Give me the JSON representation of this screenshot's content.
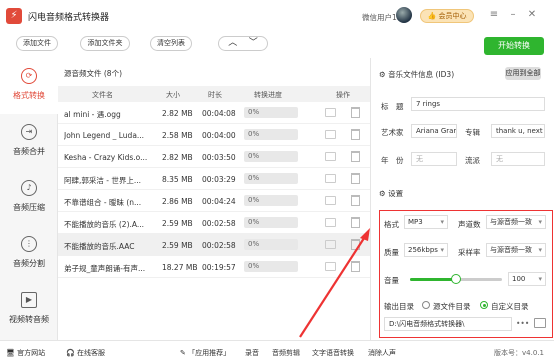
{
  "app": {
    "title": "闪电音频格式转换器",
    "username": "微信用户1",
    "member_label": "会员中心"
  },
  "toolbar": {
    "add_file": "添加文件",
    "add_folder": "添加文件夹",
    "clear_list": "清空列表",
    "nav_up": "︿",
    "nav_down": "﹀",
    "start": "开始转换"
  },
  "sidebar": {
    "items": [
      {
        "label": "格式转换",
        "icon": "convert-icon",
        "active": true
      },
      {
        "label": "音频合并",
        "icon": "merge-icon"
      },
      {
        "label": "音频压缩",
        "icon": "compress-icon"
      },
      {
        "label": "音频分割",
        "icon": "split-icon"
      },
      {
        "label": "视频转音频",
        "icon": "video-icon"
      }
    ]
  },
  "filelist": {
    "title": "源音频文件 (8个)",
    "columns": [
      "文件名",
      "大小",
      "时长",
      "转换进度",
      "操作"
    ],
    "rows": [
      {
        "name": "al mini - 遇.ogg",
        "size": "2.82 MB",
        "duration": "00:04:08",
        "progress": "0%"
      },
      {
        "name": "John Legend _ Luda...",
        "size": "2.58 MB",
        "duration": "00:04:00",
        "progress": "0%"
      },
      {
        "name": "Kesha - Crazy Kids.o...",
        "size": "2.82 MB",
        "duration": "00:03:50",
        "progress": "0%"
      },
      {
        "name": "阿肆,郭采洁 - 世界上...",
        "size": "8.35 MB",
        "duration": "00:03:29",
        "progress": "0%"
      },
      {
        "name": "不靠谱组合 - 暧昧 (n...",
        "size": "2.86 MB",
        "duration": "00:04:24",
        "progress": "0%"
      },
      {
        "name": "不能播放的音乐 (2).A...",
        "size": "2.59 MB",
        "duration": "00:02:58",
        "progress": "0%"
      },
      {
        "name": "不能播放的音乐.AAC",
        "size": "2.59 MB",
        "duration": "00:02:58",
        "progress": "0%"
      },
      {
        "name": "弟子规_童声朗诵-有声...",
        "size": "18.27 MB",
        "duration": "00:19:57",
        "progress": "0%"
      }
    ]
  },
  "id3": {
    "title": "音乐文件信息 (ID3)",
    "apply_all": "应用到全部",
    "labels": {
      "title": "标　题",
      "artist": "艺术家",
      "album": "专辑",
      "year": "年　份",
      "genre": "流派"
    },
    "values": {
      "title": "7 rings",
      "artist": "Ariana Grar",
      "album": "thank u, next",
      "year": "无",
      "genre": "无"
    }
  },
  "settings": {
    "title": "设置",
    "format_label": "格式",
    "format_value": "MP3",
    "channels_label": "声道数",
    "channels_value": "与源音频一致",
    "quality_label": "质量",
    "quality_value": "256kbps",
    "samplerate_label": "采样率",
    "samplerate_value": "与源音频一致",
    "volume_label": "音量",
    "volume_value": "100",
    "volume_fraction": 0.5,
    "output_label": "输出目录",
    "opt_source": "源文件目录",
    "opt_custom": "自定义目录",
    "output_path": "D:\\闪电音频格式转换器\\",
    "path_more": "•••"
  },
  "footer": {
    "website": "官方网站",
    "feedback": "在线客服",
    "links": [
      "「应用推荐」",
      "录音",
      "音频剪辑",
      "文字语音转换",
      "消除人声"
    ],
    "version": "版本号：v4.0.1"
  }
}
